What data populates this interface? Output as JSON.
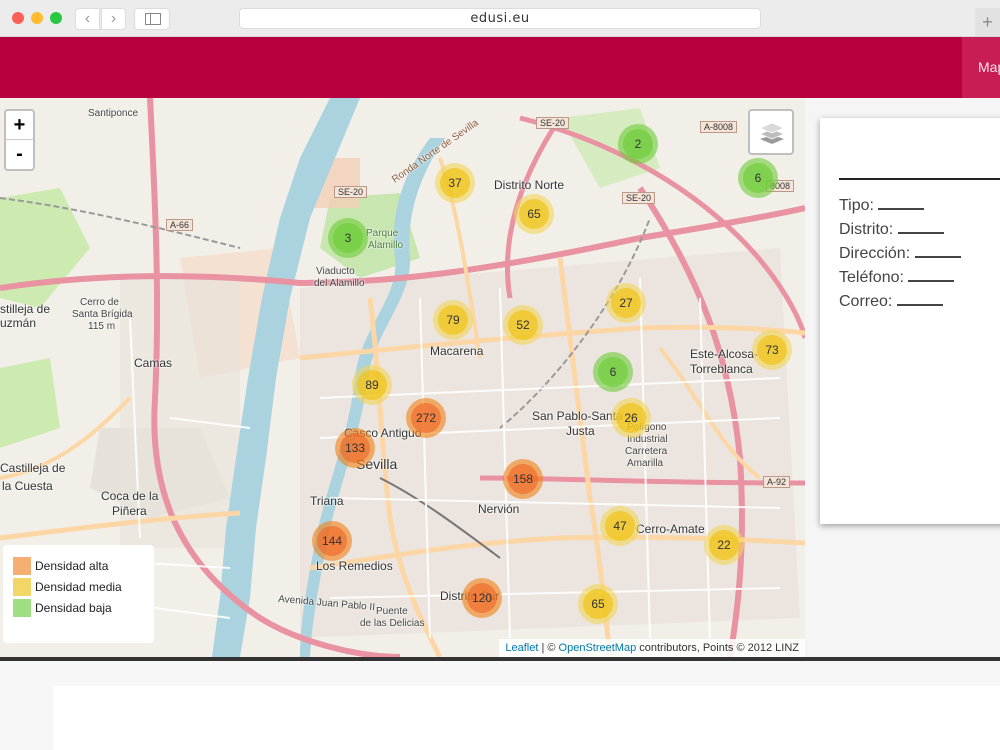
{
  "browser": {
    "url": "edusi.eu",
    "back_glyph": "‹",
    "forward_glyph": "›",
    "new_tab_glyph": "+"
  },
  "header": {
    "nav_item": "Map",
    "brand_color": "#b8003f"
  },
  "map": {
    "zoom_in": "+",
    "zoom_out": "-",
    "layers_icon": "layers-icon",
    "legend": [
      {
        "label": "Densidad alta",
        "color": "#f4a05a"
      },
      {
        "label": "Densidad media",
        "color": "#f0d04e"
      },
      {
        "label": "Densidad baja",
        "color": "#8ed96f"
      }
    ],
    "attribution": {
      "leaflet": "Leaflet",
      "separator": " | © ",
      "osm": "OpenStreetMap",
      "rest": " contributors, Points © 2012 LINZ"
    },
    "clusters": [
      {
        "count": "2",
        "density": "low"
      },
      {
        "count": "6",
        "density": "low"
      },
      {
        "count": "37",
        "density": "med"
      },
      {
        "count": "65",
        "density": "med"
      },
      {
        "count": "3",
        "density": "low"
      },
      {
        "count": "27",
        "density": "med"
      },
      {
        "count": "79",
        "density": "med"
      },
      {
        "count": "52",
        "density": "med"
      },
      {
        "count": "73",
        "density": "med"
      },
      {
        "count": "6",
        "density": "low"
      },
      {
        "count": "89",
        "density": "med"
      },
      {
        "count": "272",
        "density": "high"
      },
      {
        "count": "26",
        "density": "med"
      },
      {
        "count": "133",
        "density": "high"
      },
      {
        "count": "158",
        "density": "high"
      },
      {
        "count": "47",
        "density": "med"
      },
      {
        "count": "22",
        "density": "med"
      },
      {
        "count": "144",
        "density": "high"
      },
      {
        "count": "120",
        "density": "high"
      },
      {
        "count": "65",
        "density": "med"
      }
    ],
    "labels": {
      "santiponce": "Santiponce",
      "distrito_norte": "Distrito Norte",
      "viaducto": "Viaducto",
      "del_alamillo": "del Alamillo",
      "parque_alamillo": "Parque",
      "alamillo": "Alamillo",
      "cerro": "Cerro de",
      "santa_brigida": "Santa Brígida",
      "m115": "115 m",
      "castilleja_guzman": "stilleja de",
      "guzman": "uzmán",
      "camas": "Camas",
      "macarena": "Macarena",
      "este_alcosa": "Este-Alcosa-",
      "torreblanca": "Torreblanca",
      "casco_antiguo": "Casco Antiguo",
      "sevilla": "Sevilla",
      "san_pablo": "San Pablo-Santa",
      "justa": "Justa",
      "poligono": "Polígono",
      "industrial": "Industrial",
      "carretera": "Carretera",
      "amarilla": "Amarilla",
      "castilleja_cuesta": "Castilleja de",
      "la_cuesta": "la Cuesta",
      "coca": "Coca de la",
      "pinera": "Piñera",
      "triana": "Triana",
      "nervion": "Nervión",
      "cerro_amate": "Cerro-Amate",
      "los_remedios": "Los Remedios",
      "distrito_sur": "Distrito Sur",
      "puente": "Puente",
      "delicias": "de las Delicias",
      "se20a": "SE-20",
      "se20b": "SE-20",
      "se20c": "SE-20",
      "a8008a": "A-8008",
      "a8008b": "8008",
      "a66": "A-66",
      "a92": "A-92",
      "ronda": "Ronda Norte de Sevilla",
      "avenida_juan_pablo": "Avenida Juan Pablo II"
    }
  },
  "info": {
    "tipo": "Tipo:",
    "distrito": "Distrito:",
    "direccion": "Dirección:",
    "telefono": "Teléfono:",
    "correo": "Correo:"
  }
}
